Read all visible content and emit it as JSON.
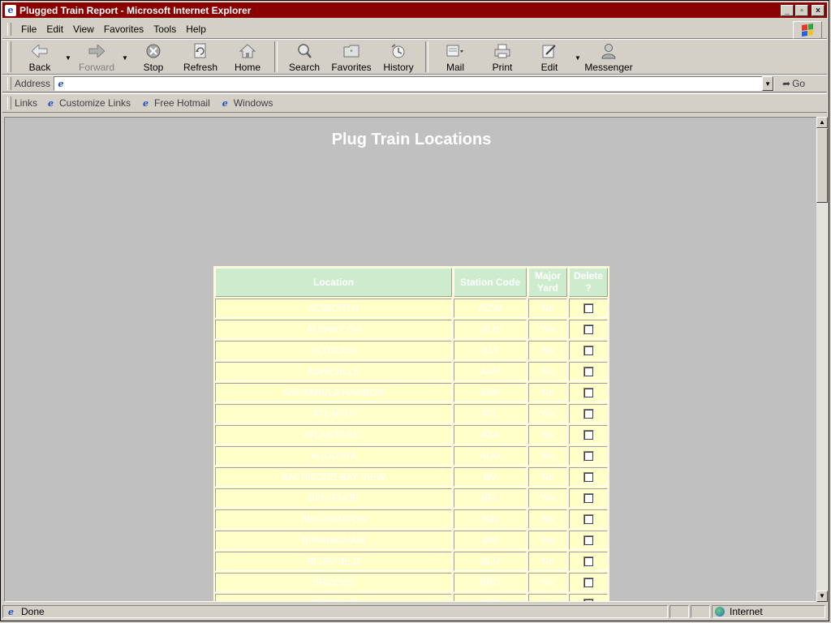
{
  "window": {
    "title": "Plugged Train Report - Microsoft Internet Explorer",
    "controls": [
      "_",
      "▫",
      "×"
    ]
  },
  "menu": {
    "items": [
      {
        "label": "File"
      },
      {
        "label": "Edit"
      },
      {
        "label": "View"
      },
      {
        "label": "Favorites"
      },
      {
        "label": "Tools"
      },
      {
        "label": "Help"
      }
    ]
  },
  "toolbar": {
    "back": "Back",
    "forward": "Forward",
    "stop": "Stop",
    "refresh": "Refresh",
    "home": "Home",
    "search": "Search",
    "favorites": "Favorites",
    "history": "History",
    "mail": "Mail",
    "print": "Print",
    "edit": "Edit",
    "messenger": "Messenger"
  },
  "address": {
    "label": "Address",
    "value": "",
    "go": "Go"
  },
  "links": {
    "label": "Links",
    "items": [
      {
        "label": "Customize Links"
      },
      {
        "label": "Free Hotmail"
      },
      {
        "label": "Windows"
      }
    ]
  },
  "page": {
    "title": "Plug Train Locations",
    "columns": {
      "location": "Location",
      "station_code": "Station Code",
      "major_yard": "Major Yard",
      "delete": "Delete ?"
    },
    "rows": [
      {
        "location": "ACWORTH",
        "code": "ACW",
        "yard": "No",
        "delete": false
      },
      {
        "location": "ALBANY GA",
        "code": "ALB",
        "yard": "Yes",
        "delete": false
      },
      {
        "location": "ALTOONA",
        "code": "ALT",
        "yard": "No",
        "delete": false
      },
      {
        "location": "ASHEVILLE",
        "code": "ASH",
        "yard": "No",
        "delete": false
      },
      {
        "location": "ASHTABULA HARBOR",
        "code": "ASH",
        "yard": "No",
        "delete": false
      },
      {
        "location": "ATLANTA",
        "code": "ATL",
        "yard": "Yes",
        "delete": false
      },
      {
        "location": "ATLANTA ALT",
        "code": "ATA",
        "yard": "No",
        "delete": false
      },
      {
        "location": "AUGUSTA",
        "code": "AUG",
        "yard": "No",
        "delete": false
      },
      {
        "location": "BALTIMORE BAY VIEW",
        "code": "BV",
        "yard": "No",
        "delete": false
      },
      {
        "location": "BELLEVUE",
        "code": "BEL",
        "yard": "Yes",
        "delete": false
      },
      {
        "location": "BINGHAMTON",
        "code": "BIN",
        "yard": "No",
        "delete": false
      },
      {
        "location": "BIRMINGHAM",
        "code": "BM",
        "yard": "Yes",
        "delete": false
      },
      {
        "location": "BLUEFIELD",
        "code": "BLU",
        "yard": "No",
        "delete": false
      },
      {
        "location": "BROOKS",
        "code": "BRO",
        "yard": "No",
        "delete": false
      },
      {
        "location": "BUFFALO",
        "code": "BUF",
        "yard": "No",
        "delete": false
      }
    ]
  },
  "status": {
    "text": "Done",
    "zone": "Internet"
  }
}
